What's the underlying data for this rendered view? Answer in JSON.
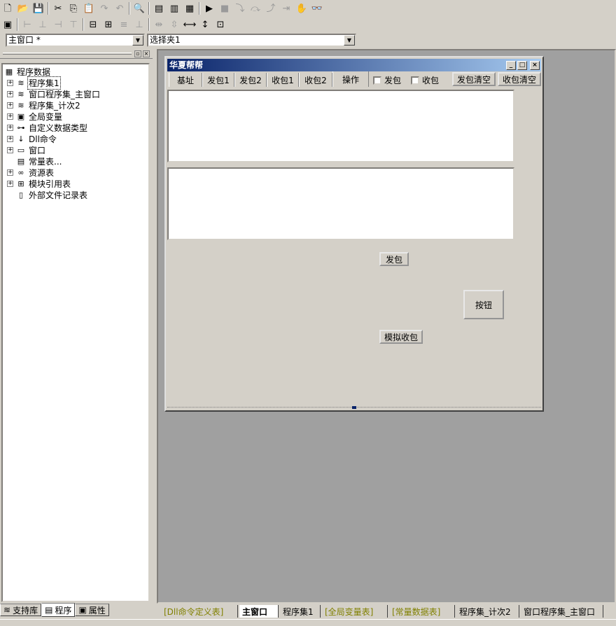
{
  "toolbar": {
    "row1": [
      "new-file-icon",
      "open-folder-icon",
      "save-icon",
      "cut-icon",
      "copy-icon",
      "paste-icon",
      "redo-icon",
      "undo-icon",
      "find-icon",
      "layout-a-icon",
      "layout-b-icon",
      "layout-c-icon",
      "run-icon",
      "stop-icon",
      "step-into-icon",
      "step-over-icon",
      "step-out-icon",
      "run-to-cursor-icon",
      "breakpoint-hand-icon",
      "watch-icon"
    ],
    "row2": [
      "form-icon",
      "align-left-icon",
      "align-center-icon",
      "align-right-icon",
      "align-top-icon",
      "center-h-icon",
      "center-v-icon",
      "align-middle-icon",
      "align-bottom-icon",
      "space-h-icon",
      "space-v-icon",
      "same-width-icon",
      "same-height-icon",
      "same-size-icon"
    ]
  },
  "combos": {
    "window": "主窗口 *",
    "component": "选择夹1"
  },
  "tree": {
    "root": "程序数据",
    "items": [
      {
        "label": "程序集1",
        "icon": "module-icon",
        "expand": "+"
      },
      {
        "label": "窗口程序集_主窗口",
        "icon": "module-icon",
        "expand": "+"
      },
      {
        "label": "程序集_计次2",
        "icon": "module-icon",
        "expand": "+"
      },
      {
        "label": "全局变量",
        "icon": "global-var-icon",
        "expand": "+"
      },
      {
        "label": "自定义数据类型",
        "icon": "datatype-icon",
        "expand": "+"
      },
      {
        "label": "Dll命令",
        "icon": "dll-icon",
        "expand": "+"
      },
      {
        "label": "窗口",
        "icon": "window-icon",
        "expand": "+"
      },
      {
        "label": "常量表...",
        "icon": "constant-icon",
        "expand": ""
      },
      {
        "label": "资源表",
        "icon": "resource-icon",
        "expand": "+"
      },
      {
        "label": "模块引用表",
        "icon": "module-ref-icon",
        "expand": "+"
      },
      {
        "label": "外部文件记录表",
        "icon": "external-file-icon",
        "expand": ""
      }
    ]
  },
  "left_tabs": [
    "支持库",
    "程序",
    "属性"
  ],
  "form": {
    "title": "华夏帮帮",
    "tabs": [
      "基址",
      "发包1",
      "发包2",
      "收包1",
      "收包2",
      "操作"
    ],
    "checkboxes": [
      "发包",
      "收包"
    ],
    "buttons": {
      "clear_send": "发包清空",
      "clear_recv": "收包清空",
      "send": "发包",
      "button": "按钮",
      "sim_recv": "模拟收包"
    }
  },
  "doc_tabs": [
    {
      "label": "[Dll命令定义表]",
      "style": "gray"
    },
    {
      "label": "主窗口",
      "style": "active"
    },
    {
      "label": "程序集1",
      "style": "normal"
    },
    {
      "label": "[全局变量表]",
      "style": "gray"
    },
    {
      "label": "[常量数据表]",
      "style": "gray"
    },
    {
      "label": "程序集_计次2",
      "style": "normal"
    },
    {
      "label": "窗口程序集_主窗口",
      "style": "normal"
    }
  ],
  "icon_glyphs": {
    "new-file-icon": "🗋",
    "open-folder-icon": "📂",
    "save-icon": "💾",
    "cut-icon": "✂",
    "copy-icon": "⎘",
    "paste-icon": "📋",
    "redo-icon": "↷",
    "undo-icon": "↶",
    "find-icon": "🔍",
    "layout-a-icon": "▤",
    "layout-b-icon": "▥",
    "layout-c-icon": "▦",
    "run-icon": "▶",
    "stop-icon": "■",
    "step-into-icon": "⤵",
    "step-over-icon": "⤼",
    "step-out-icon": "⤴",
    "run-to-cursor-icon": "⇥",
    "breakpoint-hand-icon": "✋",
    "watch-icon": "👓",
    "form-icon": "▣",
    "align-left-icon": "⊢",
    "align-center-icon": "⊥",
    "align-right-icon": "⊣",
    "align-top-icon": "⊤",
    "center-h-icon": "⊟",
    "center-v-icon": "⊞",
    "align-middle-icon": "≡",
    "align-bottom-icon": "⊥",
    "space-h-icon": "⇹",
    "space-v-icon": "⇳",
    "same-width-icon": "⟷",
    "same-height-icon": "↕",
    "same-size-icon": "⊡",
    "module-icon": "≋",
    "global-var-icon": "▣",
    "datatype-icon": "⊶",
    "dll-icon": "↓",
    "window-icon": "▭",
    "constant-icon": "▤",
    "resource-icon": "∞",
    "module-ref-icon": "⊞",
    "external-file-icon": "▯",
    "root-icon": "▦"
  }
}
